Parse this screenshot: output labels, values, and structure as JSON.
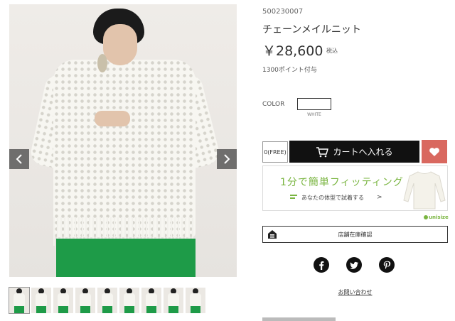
{
  "product": {
    "code": "500230007",
    "name": "チェーンメイルニット",
    "price": "￥28,600",
    "tax": "税込",
    "points": "1300ポイント付与"
  },
  "color": {
    "label": "COLOR",
    "selected": "WHITE",
    "swatch_color": "#ffffff"
  },
  "size": {
    "selected": "0(FREE)"
  },
  "cart": {
    "label": "カートへ入れる",
    "bg_color": "#111111"
  },
  "favorite": {
    "bg_color": "#d9685f"
  },
  "fitting": {
    "title": "1分で簡単フィッティング",
    "subtitle": "あなたの体型で試着する",
    "chevron": ">",
    "brand": "unisize",
    "accent": "#7ab541"
  },
  "store": {
    "label": "店舗在庫確認"
  },
  "social": [
    "facebook",
    "twitter",
    "pinterest"
  ],
  "contact": {
    "label": "お問い合わせ"
  },
  "gallery": {
    "thumbnail_count": 9,
    "active_index": 0
  }
}
